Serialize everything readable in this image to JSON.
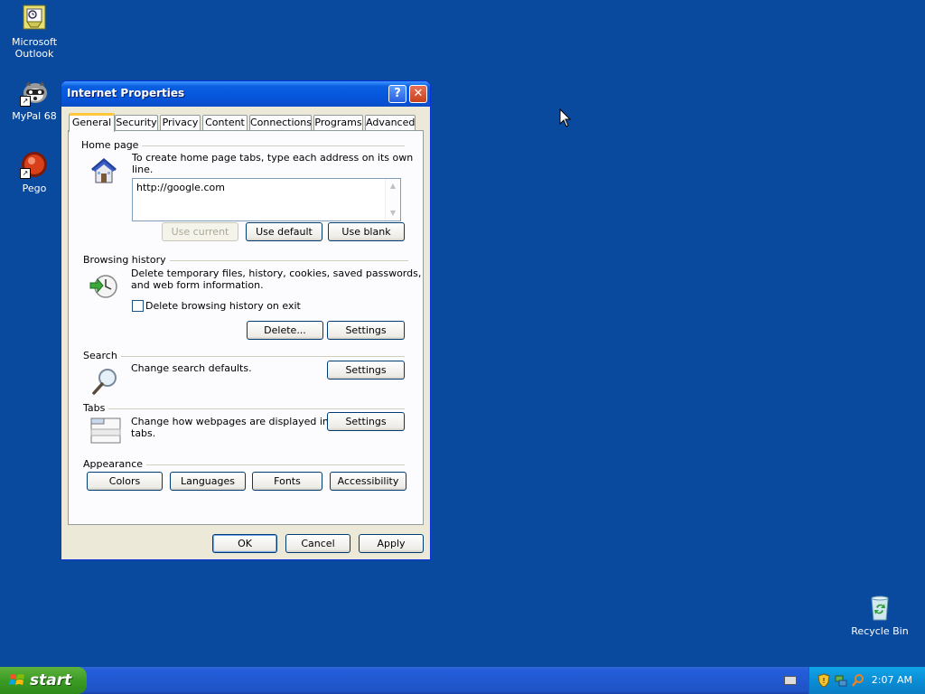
{
  "desktop": {
    "icons": [
      {
        "label_line1": "Microsoft",
        "label_line2": "Outlook"
      },
      {
        "label_line1": "MyPal 68",
        "label_line2": ""
      },
      {
        "label_line1": "Pego",
        "label_line2": ""
      },
      {
        "label_line1": "Recycle Bin",
        "label_line2": ""
      }
    ]
  },
  "window": {
    "title": "Internet Properties",
    "help_glyph": "?",
    "close_glyph": "✕"
  },
  "tabs": [
    "General",
    "Security",
    "Privacy",
    "Content",
    "Connections",
    "Programs",
    "Advanced"
  ],
  "home_page": {
    "heading": "Home page",
    "instruction": "To create home page tabs, type each address on its own line.",
    "value": "http://google.com",
    "buttons": {
      "use_current": "Use current",
      "use_default": "Use default",
      "use_blank": "Use blank"
    }
  },
  "browsing_history": {
    "heading": "Browsing history",
    "description_line1": "Delete temporary files, history, cookies, saved passwords,",
    "description_line2": "and web form information.",
    "checkbox_label": "Delete browsing history on exit",
    "checkbox_checked": false,
    "buttons": {
      "delete": "Delete...",
      "settings": "Settings"
    }
  },
  "search": {
    "heading": "Search",
    "description": "Change search defaults.",
    "settings": "Settings"
  },
  "tabs_section": {
    "heading": "Tabs",
    "description_line1": "Change how webpages are displayed in",
    "description_line2": "tabs.",
    "settings": "Settings"
  },
  "appearance": {
    "heading": "Appearance",
    "buttons": {
      "colors": "Colors",
      "languages": "Languages",
      "fonts": "Fonts",
      "accessibility": "Accessibility"
    }
  },
  "dialog_buttons": {
    "ok": "OK",
    "cancel": "Cancel",
    "apply": "Apply"
  },
  "taskbar": {
    "start_label": "start",
    "clock": "2:07 AM"
  }
}
